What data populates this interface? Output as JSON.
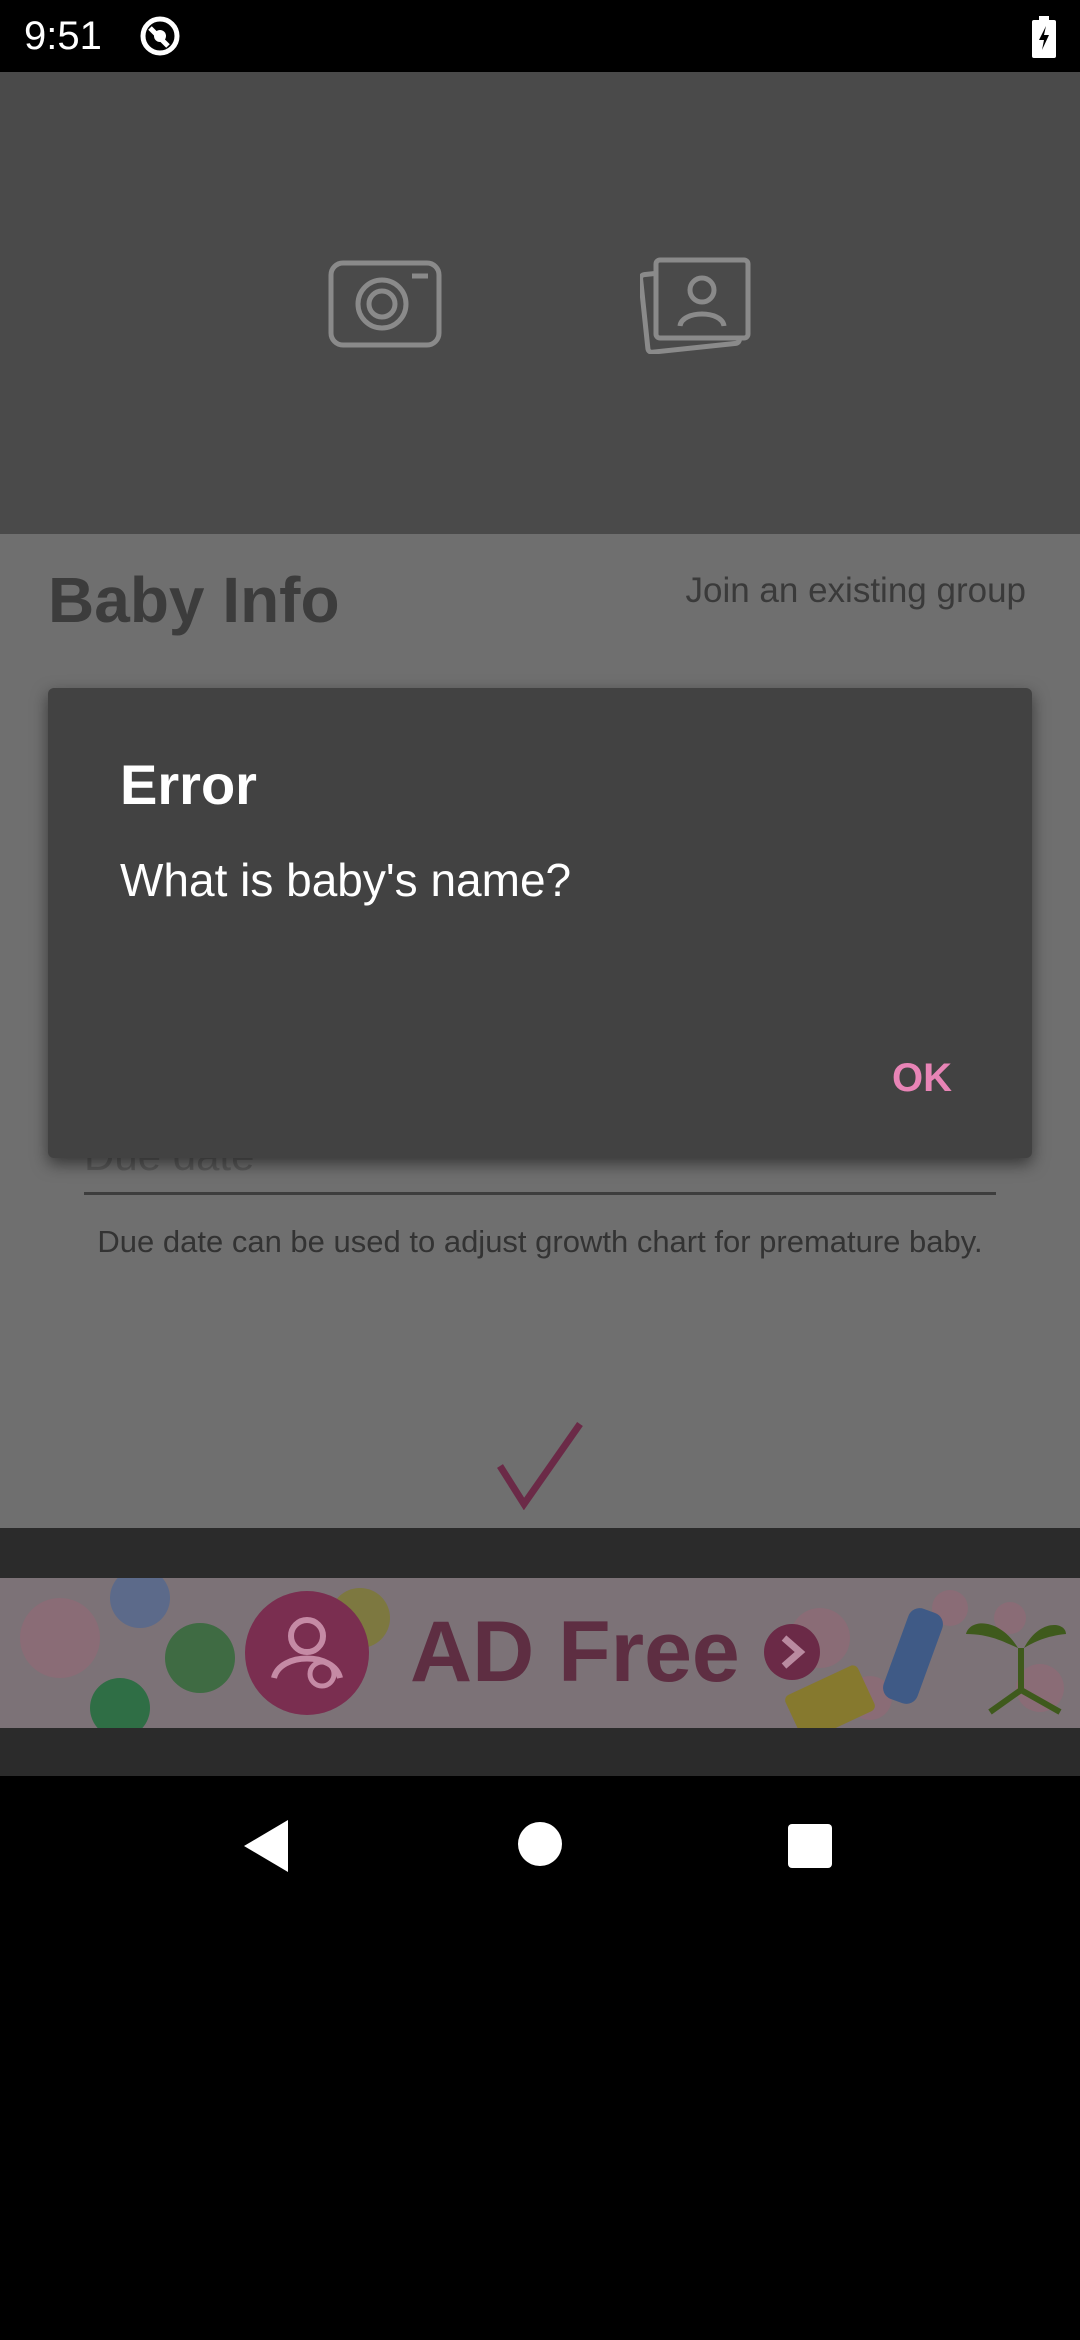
{
  "status_bar": {
    "time": "9:51"
  },
  "form": {
    "title": "Baby Info",
    "join_group": "Join an existing group",
    "due_date_placeholder": "Due date",
    "due_date_hint": "Due date can be used to adjust growth chart for premature baby."
  },
  "ad": {
    "text": "AD Free"
  },
  "dialog": {
    "title": "Error",
    "message": "What is baby's name?",
    "ok_label": "OK"
  },
  "colors": {
    "accent": "#e884b6",
    "dialog_bg": "#424242",
    "ad_brand": "#5e2e42"
  },
  "icons": {
    "status_sync": "sync-icon",
    "battery": "battery-charging-icon",
    "camera": "camera-icon",
    "gallery": "gallery-icon",
    "check": "check-icon",
    "nav_back": "back-icon",
    "nav_home": "home-icon",
    "nav_recents": "recents-icon"
  }
}
